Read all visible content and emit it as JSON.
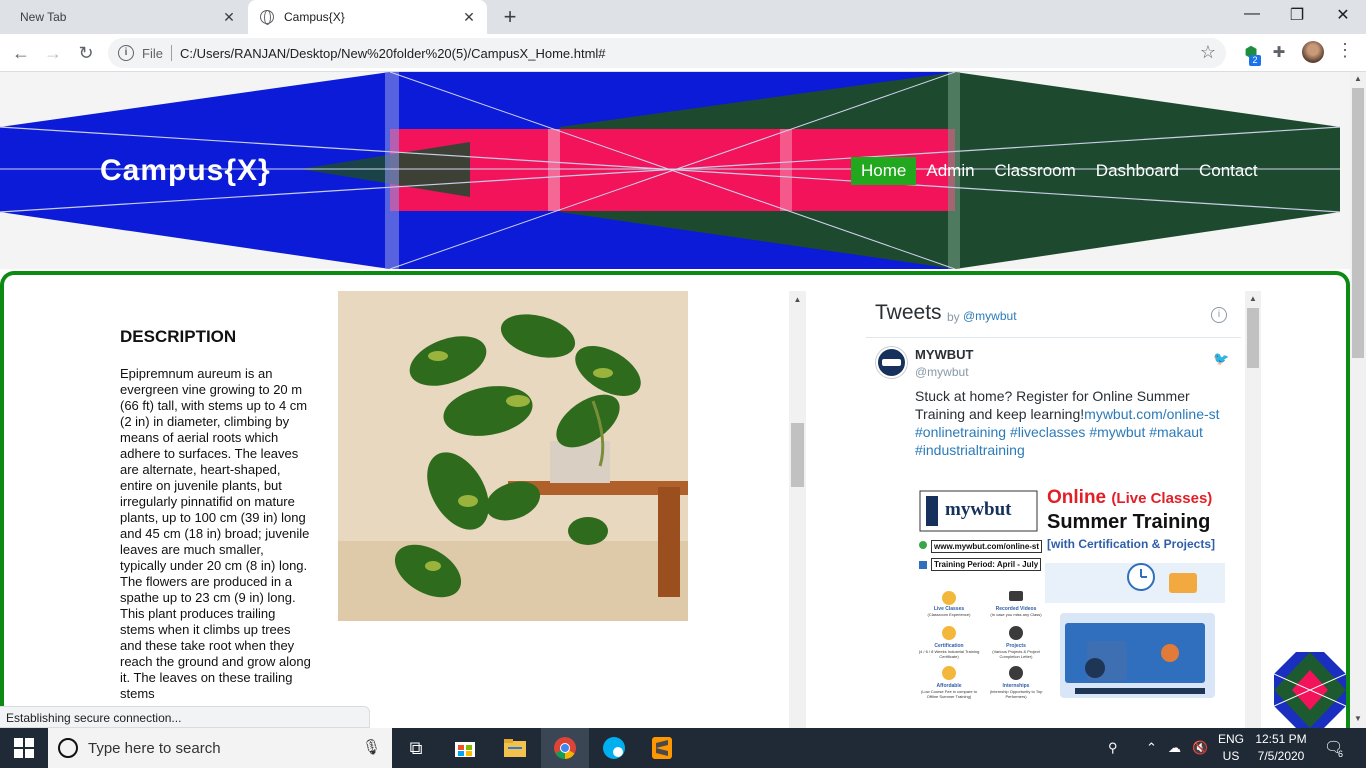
{
  "browser": {
    "tabs": [
      {
        "title": "New Tab",
        "active": false
      },
      {
        "title": "Campus{X}",
        "active": true
      }
    ],
    "address": {
      "scheme_label": "File",
      "url": "C:/Users/RANJAN/Desktop/New%20folder%20(5)/CampusX_Home.html#"
    },
    "extension_badge": "2",
    "status_text": "Establishing secure connection..."
  },
  "site": {
    "brand": "Campus{X}",
    "nav": [
      "Home",
      "Admin",
      "Classroom",
      "Dashboard",
      "Contact"
    ],
    "active_nav": "Home",
    "description": {
      "title": "DESCRIPTION",
      "text": "Epipremnum aureum is an evergreen vine growing to 20 m (66 ft) tall, with stems up to 4 cm (2 in) in diameter, climbing by means of aerial roots which adhere to surfaces. The leaves are alternate, heart-shaped, entire on juvenile plants, but irregularly pinnatifid on mature plants, up to 100 cm (39 in) long and 45 cm (18 in) broad; juvenile leaves are much smaller, typically under 20 cm (8 in) long. The flowers are produced in a spathe up to 23 cm (9 in) long. This plant produces trailing stems when it climbs up trees and these take root when they reach the ground and grow along it. The leaves on these trailing stems"
    }
  },
  "twitter": {
    "title": "Tweets",
    "by": "by",
    "handle": "@mywbut",
    "tweet": {
      "name": "MYWBUT",
      "user": "@mywbut",
      "text_plain": "Stuck at home? Register for Online Summer Training and keep learning!",
      "link": "mywbut.com/online-st",
      "hashtags": "#onlinetraining #liveclasses #mywbut #makaut #industrialtraining"
    },
    "promo": {
      "logo": "mywbut",
      "headline1": "Online",
      "headline1b": "(Live Classes)",
      "headline2": "Summer Training",
      "headline3": "[with Certification & Projects]",
      "web": "www.mywbut.com/online-st",
      "period": "Training Period: April - July",
      "features": [
        {
          "title": "Live Classes",
          "sub": "(Classroom Experience)"
        },
        {
          "title": "Recorded Videos",
          "sub": "(In case you miss any Class)"
        },
        {
          "title": "Certification",
          "sub": "(4 / 6 / 8 Weeks Industrial Training Certificate)"
        },
        {
          "title": "Projects",
          "sub": "(Various Projects & Project Completion Letter)"
        },
        {
          "title": "Affordable",
          "sub": "(Low Course Fee in compare to Offline Summer Training)"
        },
        {
          "title": "Internships",
          "sub": "(Internship Opportunity to Top Performers)"
        }
      ]
    }
  },
  "taskbar": {
    "search_placeholder": "Type here to search",
    "lang_top": "ENG",
    "lang_bottom": "US",
    "time": "12:51 PM",
    "date": "7/5/2020",
    "notification_count": "6"
  },
  "colors": {
    "active_nav": "#22a81e",
    "frame_border": "#0d8a14",
    "header_blue": "#0b1bd8",
    "header_pink": "#f2135a",
    "header_green": "#1d4a2f"
  }
}
